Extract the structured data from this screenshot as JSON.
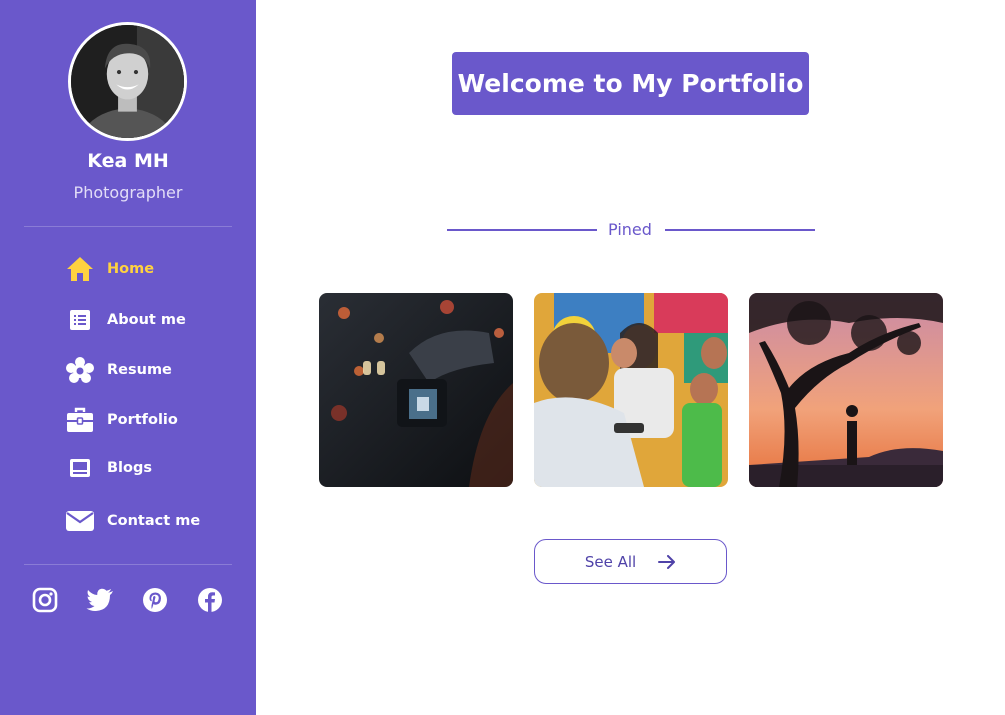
{
  "profile": {
    "name": "Kea MH",
    "role": "Photographer"
  },
  "nav": {
    "items": [
      {
        "label": "Home",
        "icon": "home-icon",
        "active": true
      },
      {
        "label": "About me",
        "icon": "list-icon",
        "active": false
      },
      {
        "label": "Resume",
        "icon": "resume-icon",
        "active": false
      },
      {
        "label": "Portfolio",
        "icon": "briefcase-icon",
        "active": false
      },
      {
        "label": "Blogs",
        "icon": "blogs-icon",
        "active": false
      },
      {
        "label": "Contact me",
        "icon": "envelope-icon",
        "active": false
      }
    ]
  },
  "social": {
    "items": [
      "instagram-icon",
      "twitter-icon",
      "pinterest-icon",
      "facebook-icon"
    ]
  },
  "main": {
    "title": "Welcome to My Portfolio",
    "pinned_label": "Pined",
    "photos": [
      "camera-photo",
      "family-photo",
      "sunset-tree-photo"
    ],
    "see_all_label": "See All"
  },
  "colors": {
    "accent": "#6a58cb",
    "active_nav": "#ffd23f",
    "sidebar_text": "#ffffff",
    "background": "#ffffff"
  }
}
